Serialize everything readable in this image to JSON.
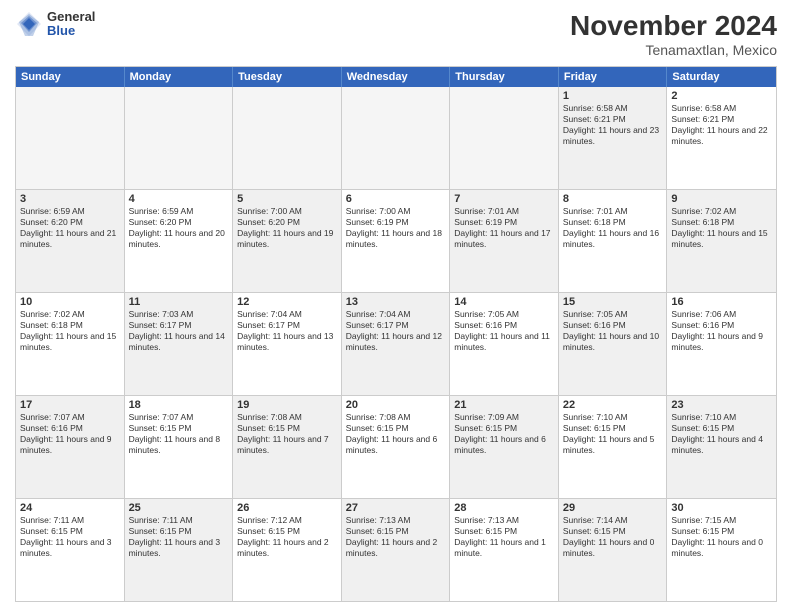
{
  "header": {
    "logo": {
      "general": "General",
      "blue": "Blue"
    },
    "title": "November 2024",
    "location": "Tenamaxtlan, Mexico"
  },
  "days": [
    "Sunday",
    "Monday",
    "Tuesday",
    "Wednesday",
    "Thursday",
    "Friday",
    "Saturday"
  ],
  "rows": [
    [
      {
        "num": "",
        "info": "",
        "empty": true
      },
      {
        "num": "",
        "info": "",
        "empty": true
      },
      {
        "num": "",
        "info": "",
        "empty": true
      },
      {
        "num": "",
        "info": "",
        "empty": true
      },
      {
        "num": "",
        "info": "",
        "empty": true
      },
      {
        "num": "1",
        "info": "Sunrise: 6:58 AM\nSunset: 6:21 PM\nDaylight: 11 hours and 23 minutes.",
        "shaded": true
      },
      {
        "num": "2",
        "info": "Sunrise: 6:58 AM\nSunset: 6:21 PM\nDaylight: 11 hours and 22 minutes.",
        "shaded": false
      }
    ],
    [
      {
        "num": "3",
        "info": "Sunrise: 6:59 AM\nSunset: 6:20 PM\nDaylight: 11 hours and 21 minutes.",
        "shaded": true
      },
      {
        "num": "4",
        "info": "Sunrise: 6:59 AM\nSunset: 6:20 PM\nDaylight: 11 hours and 20 minutes.",
        "shaded": false
      },
      {
        "num": "5",
        "info": "Sunrise: 7:00 AM\nSunset: 6:20 PM\nDaylight: 11 hours and 19 minutes.",
        "shaded": true
      },
      {
        "num": "6",
        "info": "Sunrise: 7:00 AM\nSunset: 6:19 PM\nDaylight: 11 hours and 18 minutes.",
        "shaded": false
      },
      {
        "num": "7",
        "info": "Sunrise: 7:01 AM\nSunset: 6:19 PM\nDaylight: 11 hours and 17 minutes.",
        "shaded": true
      },
      {
        "num": "8",
        "info": "Sunrise: 7:01 AM\nSunset: 6:18 PM\nDaylight: 11 hours and 16 minutes.",
        "shaded": false
      },
      {
        "num": "9",
        "info": "Sunrise: 7:02 AM\nSunset: 6:18 PM\nDaylight: 11 hours and 15 minutes.",
        "shaded": true
      }
    ],
    [
      {
        "num": "10",
        "info": "Sunrise: 7:02 AM\nSunset: 6:18 PM\nDaylight: 11 hours and 15 minutes.",
        "shaded": false
      },
      {
        "num": "11",
        "info": "Sunrise: 7:03 AM\nSunset: 6:17 PM\nDaylight: 11 hours and 14 minutes.",
        "shaded": true
      },
      {
        "num": "12",
        "info": "Sunrise: 7:04 AM\nSunset: 6:17 PM\nDaylight: 11 hours and 13 minutes.",
        "shaded": false
      },
      {
        "num": "13",
        "info": "Sunrise: 7:04 AM\nSunset: 6:17 PM\nDaylight: 11 hours and 12 minutes.",
        "shaded": true
      },
      {
        "num": "14",
        "info": "Sunrise: 7:05 AM\nSunset: 6:16 PM\nDaylight: 11 hours and 11 minutes.",
        "shaded": false
      },
      {
        "num": "15",
        "info": "Sunrise: 7:05 AM\nSunset: 6:16 PM\nDaylight: 11 hours and 10 minutes.",
        "shaded": true
      },
      {
        "num": "16",
        "info": "Sunrise: 7:06 AM\nSunset: 6:16 PM\nDaylight: 11 hours and 9 minutes.",
        "shaded": false
      }
    ],
    [
      {
        "num": "17",
        "info": "Sunrise: 7:07 AM\nSunset: 6:16 PM\nDaylight: 11 hours and 9 minutes.",
        "shaded": true
      },
      {
        "num": "18",
        "info": "Sunrise: 7:07 AM\nSunset: 6:15 PM\nDaylight: 11 hours and 8 minutes.",
        "shaded": false
      },
      {
        "num": "19",
        "info": "Sunrise: 7:08 AM\nSunset: 6:15 PM\nDaylight: 11 hours and 7 minutes.",
        "shaded": true
      },
      {
        "num": "20",
        "info": "Sunrise: 7:08 AM\nSunset: 6:15 PM\nDaylight: 11 hours and 6 minutes.",
        "shaded": false
      },
      {
        "num": "21",
        "info": "Sunrise: 7:09 AM\nSunset: 6:15 PM\nDaylight: 11 hours and 6 minutes.",
        "shaded": true
      },
      {
        "num": "22",
        "info": "Sunrise: 7:10 AM\nSunset: 6:15 PM\nDaylight: 11 hours and 5 minutes.",
        "shaded": false
      },
      {
        "num": "23",
        "info": "Sunrise: 7:10 AM\nSunset: 6:15 PM\nDaylight: 11 hours and 4 minutes.",
        "shaded": true
      }
    ],
    [
      {
        "num": "24",
        "info": "Sunrise: 7:11 AM\nSunset: 6:15 PM\nDaylight: 11 hours and 3 minutes.",
        "shaded": false
      },
      {
        "num": "25",
        "info": "Sunrise: 7:11 AM\nSunset: 6:15 PM\nDaylight: 11 hours and 3 minutes.",
        "shaded": true
      },
      {
        "num": "26",
        "info": "Sunrise: 7:12 AM\nSunset: 6:15 PM\nDaylight: 11 hours and 2 minutes.",
        "shaded": false
      },
      {
        "num": "27",
        "info": "Sunrise: 7:13 AM\nSunset: 6:15 PM\nDaylight: 11 hours and 2 minutes.",
        "shaded": true
      },
      {
        "num": "28",
        "info": "Sunrise: 7:13 AM\nSunset: 6:15 PM\nDaylight: 11 hours and 1 minute.",
        "shaded": false
      },
      {
        "num": "29",
        "info": "Sunrise: 7:14 AM\nSunset: 6:15 PM\nDaylight: 11 hours and 0 minutes.",
        "shaded": true
      },
      {
        "num": "30",
        "info": "Sunrise: 7:15 AM\nSunset: 6:15 PM\nDaylight: 11 hours and 0 minutes.",
        "shaded": false
      }
    ]
  ]
}
